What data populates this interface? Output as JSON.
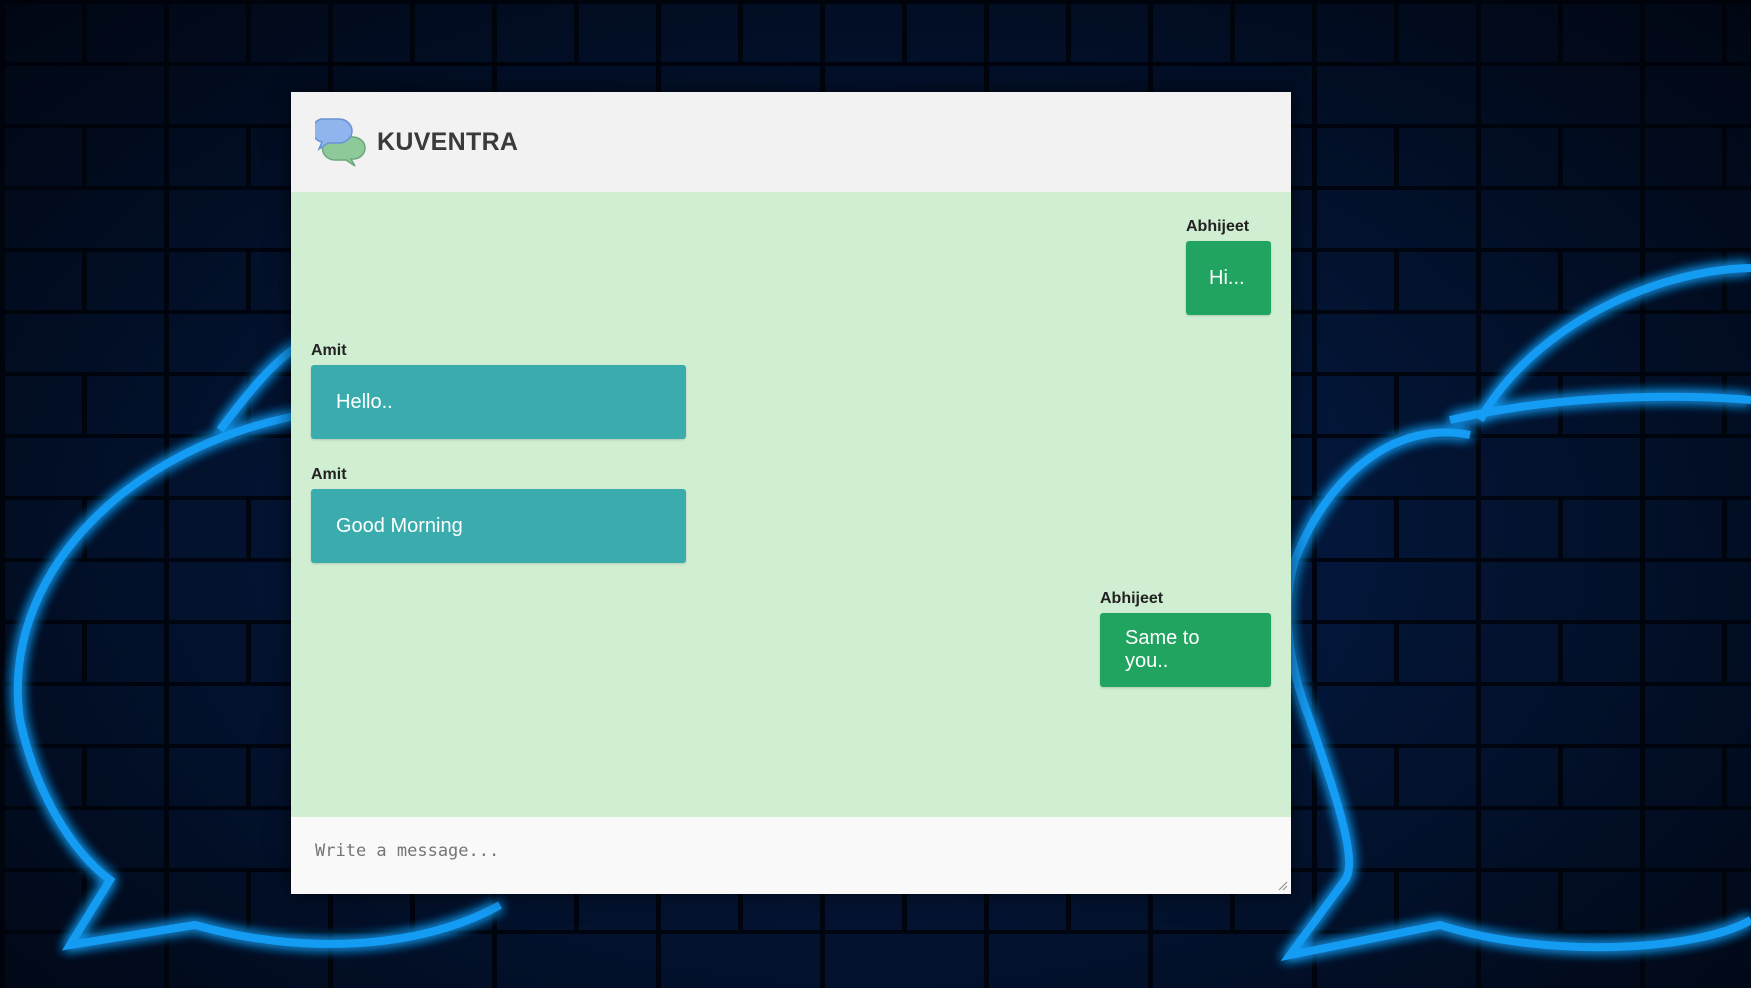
{
  "app": {
    "brand": "KUVENTRA",
    "logo_icon": "chat-bubbles-icon"
  },
  "colors": {
    "outgoing_bubble": "#21a45f",
    "incoming_bubble": "#3aacad",
    "messages_background": "#d0eed1",
    "header_background": "#f2f2f2"
  },
  "messages": [
    {
      "author": "Abhijeet",
      "text": "Hi...",
      "direction": "outgoing"
    },
    {
      "author": "Amit",
      "text": "Hello..",
      "direction": "incoming"
    },
    {
      "author": "Amit",
      "text": "Good Morning",
      "direction": "incoming"
    },
    {
      "author": "Abhijeet",
      "text": "Same to you..",
      "direction": "outgoing"
    }
  ],
  "composer": {
    "placeholder": "Write a message...",
    "value": ""
  }
}
